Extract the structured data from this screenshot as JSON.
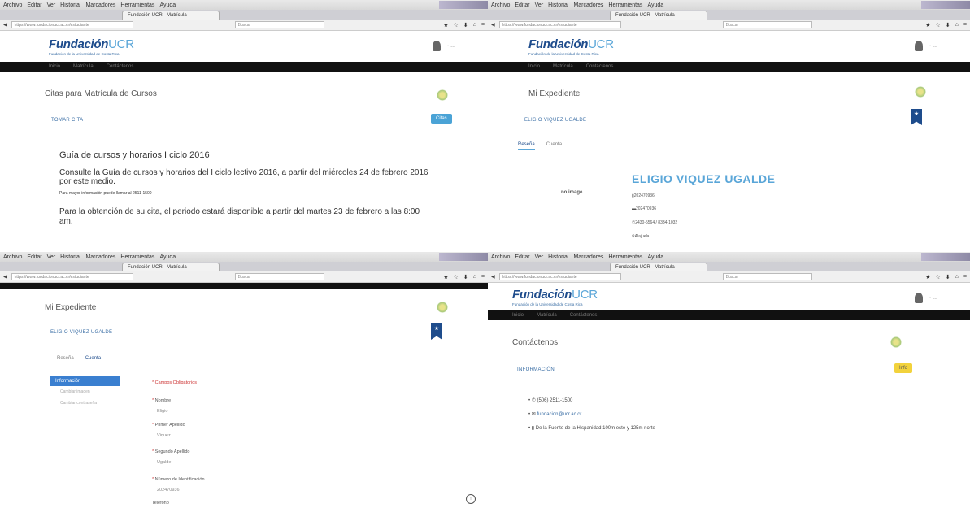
{
  "browser": {
    "menu": [
      "Archivo",
      "Editar",
      "Ver",
      "Historial",
      "Marcadores",
      "Herramientas",
      "Ayuda"
    ],
    "tab_title": "Fundación UCR - Matrícula",
    "url": "https://www.fundacionucr.ac.cr/estudiante",
    "search_placeholder": "Buscar"
  },
  "site": {
    "logo_main": "Fundación",
    "logo_ucr": "UCR",
    "logo_sub": "Fundación de la Universidad de Costa Rica",
    "nav": [
      "Inicio",
      "Matrícula",
      "Contáctenos"
    ]
  },
  "panel_tl": {
    "title": "Citas para Matrícula de Cursos",
    "take_link": "TOMAR CITA",
    "button": "Citas",
    "guide_title": "Guía de cursos y horarios I ciclo 2016",
    "guide_text": "Consulte la Guía de cursos y horarios del I ciclo lectivo 2016, a partir del miércoles 24 de febrero 2016 por este medio.",
    "guide_note": "Para mayor información puede llamar al 2511-1500",
    "guide_text2": "Para la obtención de su cita, el periodo estará disponible a partir del martes 23 de febrero a las 8:00 am."
  },
  "panel_tr": {
    "title": "Mi Expediente",
    "user_link": "ELIGIO VIQUEZ UGALDE",
    "tabs": [
      "Reseña",
      "Cuenta"
    ],
    "no_image": "no image",
    "name": "ELIGIO VIQUEZ UGALDE",
    "id1": "202470936",
    "id2": "202470936",
    "phones": "2430-5564 / 8334-1032",
    "location": "Alajuela"
  },
  "panel_bl": {
    "title": "Mi Expediente",
    "user_link": "ELIGIO VIQUEZ UGALDE",
    "tabs": [
      "Reseña",
      "Cuenta"
    ],
    "side_active": "Información",
    "side_items": [
      "Cambiar imagen",
      "Cambiar contraseña"
    ],
    "required_note": "* Campos Obligatorios",
    "fields": [
      {
        "label": "Nombre",
        "value": "Eligio"
      },
      {
        "label": "Primer Apellido",
        "value": "Viquez"
      },
      {
        "label": "Segundo Apellido",
        "value": "Ugalde"
      },
      {
        "label": "Número de Identificación",
        "value": "202470936"
      },
      {
        "label": "Teléfono",
        "value": ""
      }
    ]
  },
  "panel_br": {
    "title": "Contáctenos",
    "link": "INFORMACIÓN",
    "button": "Info",
    "phone": "(506) 2511-1500",
    "email": "fundacion@ucr.ac.cr",
    "address": "De la Fuente de la Hispanidad 100m este y 125m norte"
  },
  "colors": {
    "brand_blue": "#1e4c8c",
    "light_blue": "#5aa6d8",
    "nav_black": "#111111",
    "button_teal": "#4aa3d6",
    "button_yellow": "#f2d23c"
  }
}
